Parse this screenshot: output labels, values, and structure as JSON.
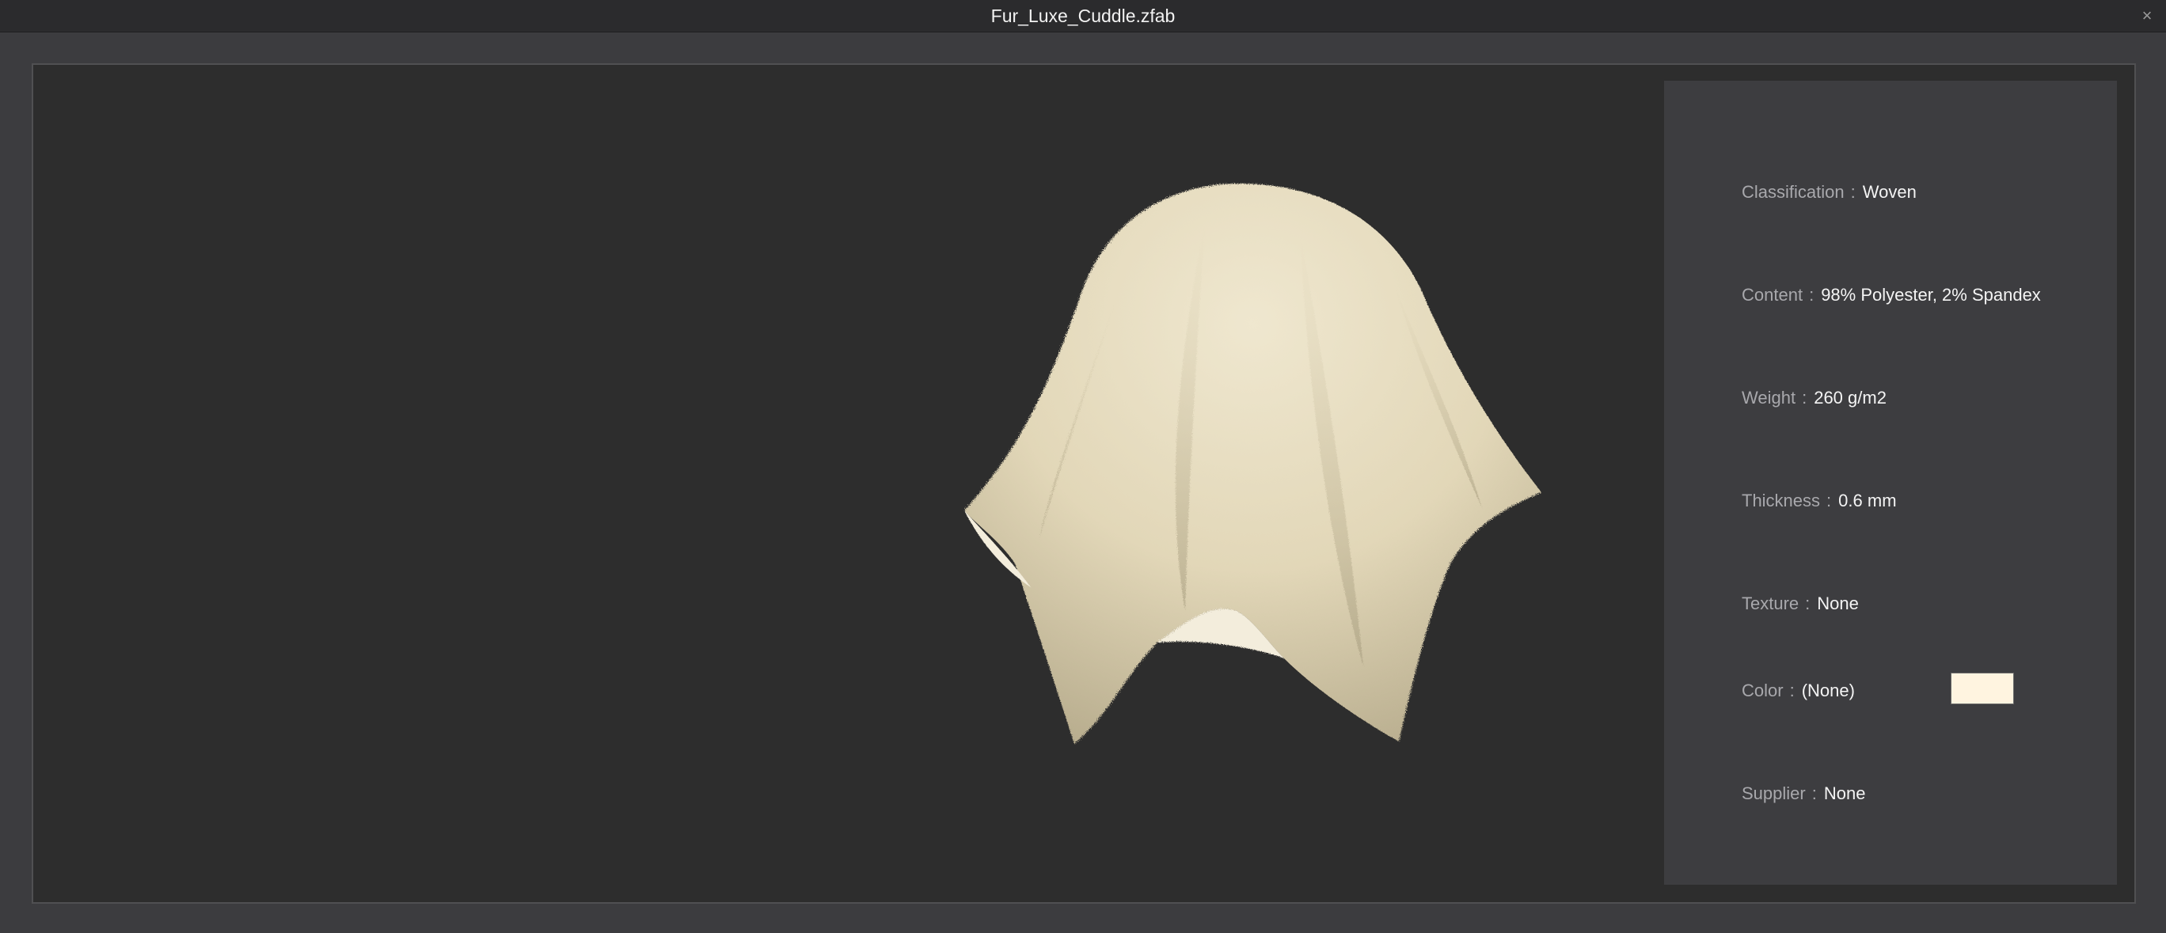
{
  "window": {
    "title": "Fur_Luxe_Cuddle.zfab",
    "close_glyph": "×"
  },
  "preview": {
    "subject": "fabric draped over sphere",
    "fabric_color": "#e6dcc0"
  },
  "properties": [
    {
      "label": "Classification",
      "value": "Woven"
    },
    {
      "label": "Content",
      "value": "98% Polyester, 2% Spandex"
    },
    {
      "label": "Weight",
      "value": "260 g/m2"
    },
    {
      "label": "Thickness",
      "value": "0.6 mm"
    },
    {
      "label": "Texture",
      "value": "None"
    },
    {
      "label": "Color",
      "value": "(None)"
    },
    {
      "label": "Supplier",
      "value": "None"
    }
  ],
  "separator": ":",
  "color_swatch": "#fff4e0"
}
